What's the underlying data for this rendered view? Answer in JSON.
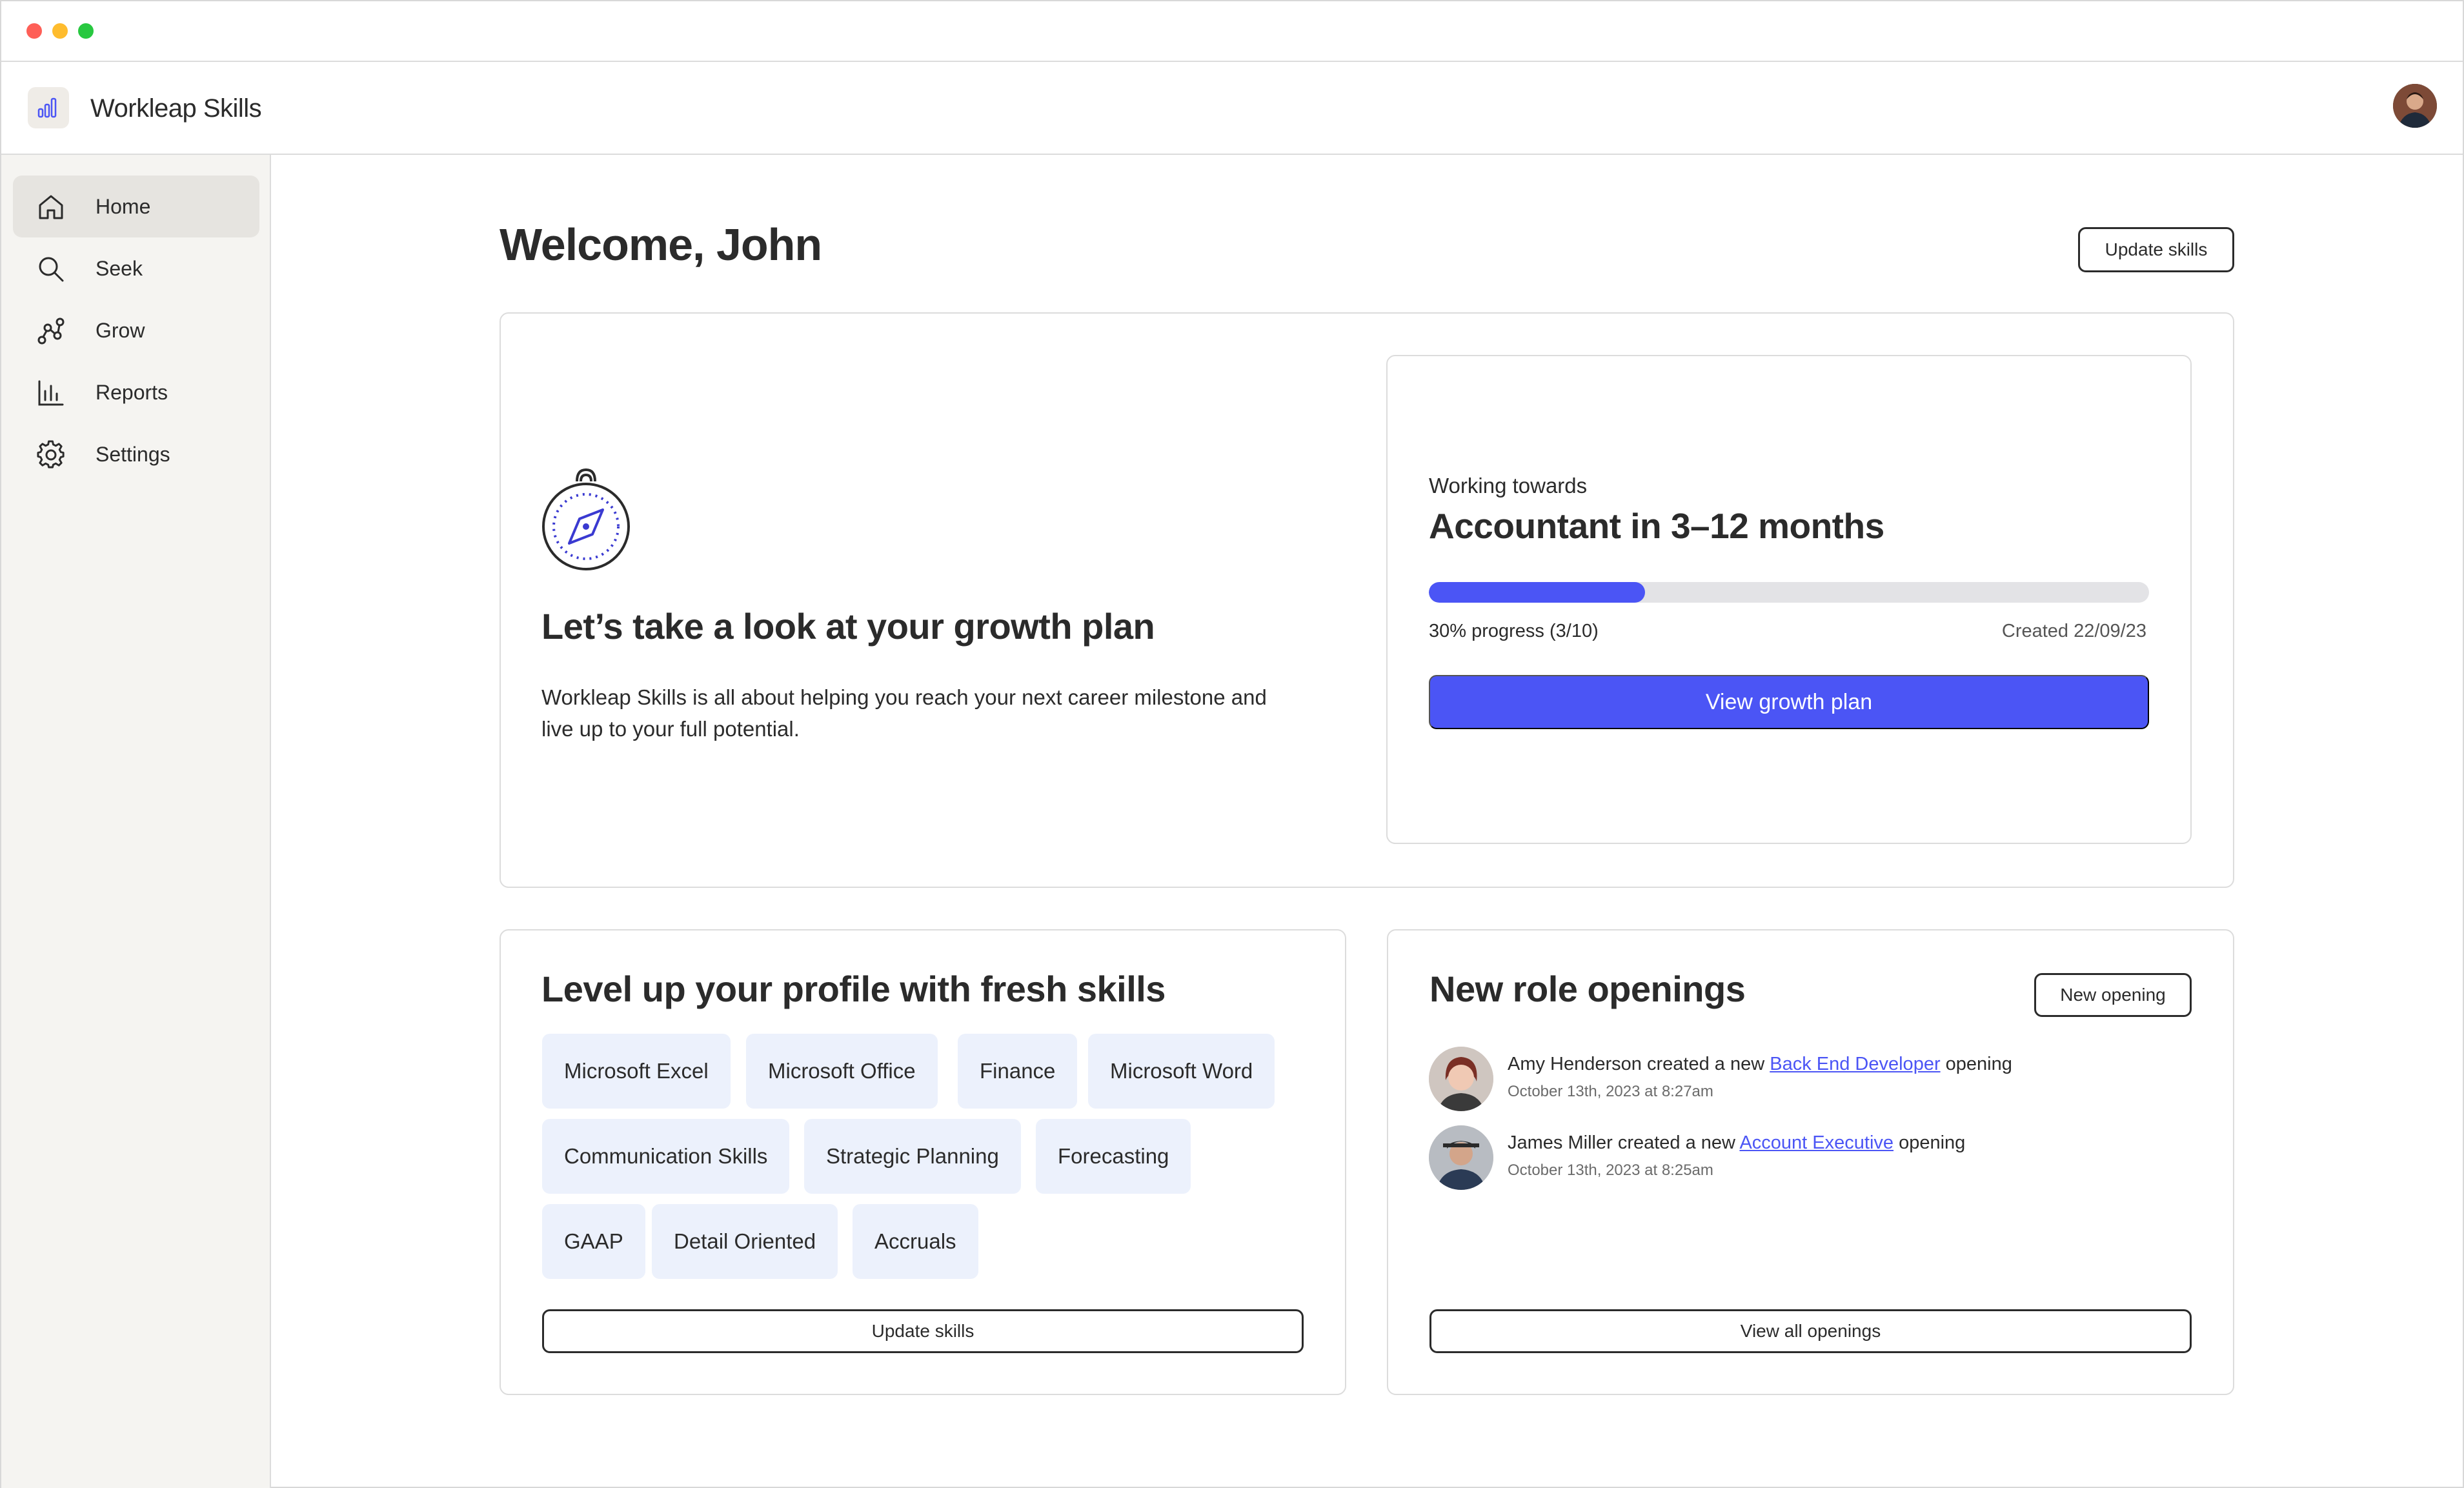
{
  "app": {
    "name": "Workleap Skills"
  },
  "sidebar": {
    "items": [
      {
        "label": "Home",
        "icon": "home-icon",
        "active": true
      },
      {
        "label": "Seek",
        "icon": "search-icon",
        "active": false
      },
      {
        "label": "Grow",
        "icon": "grow-icon",
        "active": false
      },
      {
        "label": "Reports",
        "icon": "bar-chart-icon",
        "active": false
      },
      {
        "label": "Settings",
        "icon": "gear-icon",
        "active": false
      }
    ]
  },
  "header": {
    "title": "Welcome, John",
    "update_skills_label": "Update skills"
  },
  "growth": {
    "title": "Let’s take a look at your growth plan",
    "description": "Workleap Skills is all about helping you reach your next career milestone and live up to your full potential.",
    "working_towards_label": "Working towards",
    "goal": "Accountant in 3–12 months",
    "progress_fraction": 0.3,
    "progress_text": "30% progress (3/10)",
    "created_text": "Created 22/09/23",
    "cta_label": "View growth plan"
  },
  "skills": {
    "title": "Level up your profile with fresh skills",
    "chips": [
      "Microsoft Excel",
      "Microsoft Office",
      "Finance",
      "Microsoft Word",
      "Communication Skills",
      "Strategic Planning",
      "Forecasting",
      "GAAP",
      "Detail Oriented",
      "Accruals"
    ],
    "update_label": "Update skills"
  },
  "openings": {
    "title": "New role openings",
    "new_opening_label": "New opening",
    "items": [
      {
        "user": "Amy Henderson",
        "verb": "created a new",
        "role": "Back End Developer",
        "suffix": "opening",
        "time": "October 13th, 2023 at 8:27am"
      },
      {
        "user": "James Miller",
        "verb": "created a new",
        "role": "Account Executive",
        "suffix": "opening",
        "time": "October 13th, 2023 at 8:25am"
      }
    ],
    "view_all_label": "View all openings"
  },
  "colors": {
    "accent": "#4b55f5",
    "chip_bg": "#ecf1fc",
    "sidebar_bg": "#f5f4f1",
    "sidebar_active_bg": "#e6e4e0"
  }
}
